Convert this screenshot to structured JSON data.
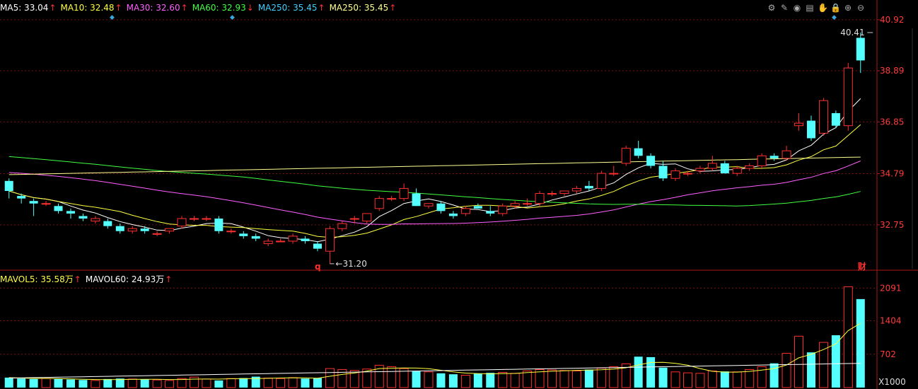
{
  "legend_top": [
    {
      "text": "MA5: 33.04",
      "arrow": "↑",
      "color": "#ffffff"
    },
    {
      "text": "MA10: 32.48",
      "arrow": "↑",
      "color": "#ffff40"
    },
    {
      "text": "MA30: 32.60",
      "arrow": "↑",
      "color": "#ff60ff"
    },
    {
      "text": "MA60: 32.93",
      "arrow": "↓",
      "color": "#40ff40"
    },
    {
      "text": "MA250: 35.45",
      "arrow": "↑",
      "color": "#40d0ff"
    },
    {
      "text": "MA250: 35.45",
      "arrow": "↑",
      "color": "#ffff90"
    }
  ],
  "legend_bottom": [
    {
      "text": "MAVOL5: 35.58万",
      "arrow": "↑",
      "color": "#ffff40"
    },
    {
      "text": "MAVOL60: 24.93万",
      "arrow": "↑",
      "color": "#ffffff"
    }
  ],
  "toolbar_icons": [
    "settings-icon",
    "pen-icon",
    "eye-icon",
    "basket-icon",
    "hand-icon",
    "lock-icon",
    "zoom-in-icon",
    "zoom-out-icon"
  ],
  "toolbar_glyphs": [
    "⚙",
    "✎",
    "◉",
    "▤",
    "✋",
    "🔒",
    "⊕",
    "⊖"
  ],
  "colors": {
    "up": "#ff3030",
    "down": "#54ffff",
    "grid": "#7a1212",
    "axis_text": "#ff3c3c"
  },
  "chart_data": [
    {
      "type": "candlestick",
      "price_axis_ticks": [
        40.92,
        38.89,
        36.85,
        34.79,
        32.75
      ],
      "ylim": [
        31.0,
        41.2
      ],
      "annotations": [
        {
          "text": "40.41",
          "index": 70,
          "price": 40.41
        },
        {
          "text": "31.20",
          "index": 26,
          "price": 31.2
        },
        {
          "text": "q",
          "index": 25
        },
        {
          "text": "财",
          "index": 69
        }
      ],
      "candles": [
        [
          34.5,
          34.6,
          33.8,
          34.1
        ],
        [
          33.9,
          34.0,
          33.6,
          33.8
        ],
        [
          33.7,
          33.8,
          33.1,
          33.6
        ],
        [
          33.6,
          33.7,
          33.5,
          33.6
        ],
        [
          33.5,
          33.6,
          33.2,
          33.3
        ],
        [
          33.3,
          33.4,
          33.0,
          33.2
        ],
        [
          33.1,
          33.2,
          32.9,
          33.0
        ],
        [
          32.9,
          33.1,
          32.8,
          33.0
        ],
        [
          32.9,
          33.0,
          32.6,
          32.7
        ],
        [
          32.7,
          32.8,
          32.4,
          32.5
        ],
        [
          32.5,
          32.7,
          32.4,
          32.6
        ],
        [
          32.6,
          32.7,
          32.4,
          32.5
        ],
        [
          32.4,
          32.5,
          32.3,
          32.4
        ],
        [
          32.5,
          32.6,
          32.4,
          32.6
        ],
        [
          32.7,
          33.1,
          32.6,
          33.0
        ],
        [
          33.0,
          33.1,
          32.9,
          33.0
        ],
        [
          33.0,
          33.1,
          32.9,
          33.0
        ],
        [
          33.0,
          33.1,
          32.4,
          32.5
        ],
        [
          32.5,
          32.6,
          32.4,
          32.5
        ],
        [
          32.4,
          32.5,
          32.2,
          32.3
        ],
        [
          32.3,
          32.4,
          32.1,
          32.2
        ],
        [
          32.0,
          32.2,
          31.9,
          32.1
        ],
        [
          32.1,
          32.2,
          32.1,
          32.1
        ],
        [
          32.1,
          32.4,
          32.0,
          32.3
        ],
        [
          32.2,
          32.3,
          32.0,
          32.1
        ],
        [
          32.0,
          32.1,
          31.7,
          31.8
        ],
        [
          31.7,
          32.7,
          31.2,
          32.6
        ],
        [
          32.6,
          32.9,
          32.5,
          32.8
        ],
        [
          33.0,
          33.1,
          32.8,
          33.0
        ],
        [
          32.9,
          33.2,
          32.8,
          33.2
        ],
        [
          33.4,
          33.9,
          33.3,
          33.8
        ],
        [
          33.8,
          33.9,
          33.7,
          33.8
        ],
        [
          33.8,
          34.4,
          33.7,
          34.2
        ],
        [
          34.0,
          34.2,
          33.5,
          33.5
        ],
        [
          33.5,
          33.6,
          33.4,
          33.6
        ],
        [
          33.6,
          33.7,
          33.2,
          33.3
        ],
        [
          33.2,
          33.3,
          33.0,
          33.1
        ],
        [
          33.2,
          33.5,
          33.1,
          33.4
        ],
        [
          33.5,
          33.6,
          33.4,
          33.4
        ],
        [
          33.3,
          33.5,
          33.1,
          33.2
        ],
        [
          33.2,
          33.6,
          33.1,
          33.5
        ],
        [
          33.5,
          33.7,
          33.4,
          33.6
        ],
        [
          33.6,
          33.8,
          33.5,
          33.6
        ],
        [
          33.6,
          34.1,
          33.5,
          34.0
        ],
        [
          34.0,
          34.1,
          33.9,
          34.0
        ],
        [
          34.0,
          34.1,
          33.9,
          34.1
        ],
        [
          34.1,
          34.3,
          34.0,
          34.2
        ],
        [
          34.3,
          34.5,
          34.1,
          34.2
        ],
        [
          34.2,
          34.9,
          34.1,
          34.8
        ],
        [
          34.8,
          35.1,
          34.7,
          34.8
        ],
        [
          35.2,
          35.9,
          35.1,
          35.8
        ],
        [
          35.8,
          36.1,
          35.4,
          35.5
        ],
        [
          35.5,
          35.6,
          35.0,
          35.1
        ],
        [
          35.1,
          35.3,
          34.5,
          34.6
        ],
        [
          34.6,
          35.0,
          34.5,
          34.9
        ],
        [
          34.8,
          34.9,
          34.7,
          34.8
        ],
        [
          34.9,
          35.1,
          34.8,
          35.0
        ],
        [
          35.0,
          35.5,
          34.9,
          35.2
        ],
        [
          35.2,
          35.3,
          34.8,
          34.8
        ],
        [
          34.8,
          35.1,
          34.7,
          35.0
        ],
        [
          35.0,
          35.2,
          34.9,
          35.1
        ],
        [
          35.1,
          35.6,
          35.0,
          35.5
        ],
        [
          35.5,
          35.6,
          35.3,
          35.4
        ],
        [
          35.4,
          35.9,
          35.3,
          35.7
        ],
        [
          36.7,
          37.2,
          36.5,
          36.8
        ],
        [
          36.9,
          37.1,
          36.1,
          36.2
        ],
        [
          36.4,
          37.8,
          36.3,
          37.7
        ],
        [
          37.2,
          37.3,
          36.6,
          36.7
        ],
        [
          36.7,
          39.2,
          36.5,
          39.0
        ],
        [
          40.2,
          40.41,
          38.8,
          39.3
        ]
      ]
    },
    {
      "type": "bar",
      "series": "volume",
      "axis_ticks": [
        2091,
        1404,
        702
      ],
      "unit_label": "X1000",
      "ylim": [
        0,
        2200
      ],
      "values": [
        210,
        190,
        180,
        190,
        180,
        170,
        160,
        150,
        180,
        190,
        180,
        170,
        160,
        150,
        190,
        220,
        180,
        150,
        190,
        200,
        230,
        200,
        190,
        210,
        190,
        200,
        400,
        380,
        360,
        390,
        470,
        440,
        400,
        350,
        330,
        300,
        280,
        260,
        300,
        310,
        320,
        300,
        350,
        380,
        370,
        360,
        350,
        380,
        410,
        440,
        500,
        650,
        640,
        420,
        330,
        310,
        300,
        350,
        340,
        330,
        380,
        440,
        510,
        720,
        1080,
        740,
        950,
        1100,
        2120,
        1860
      ]
    }
  ]
}
